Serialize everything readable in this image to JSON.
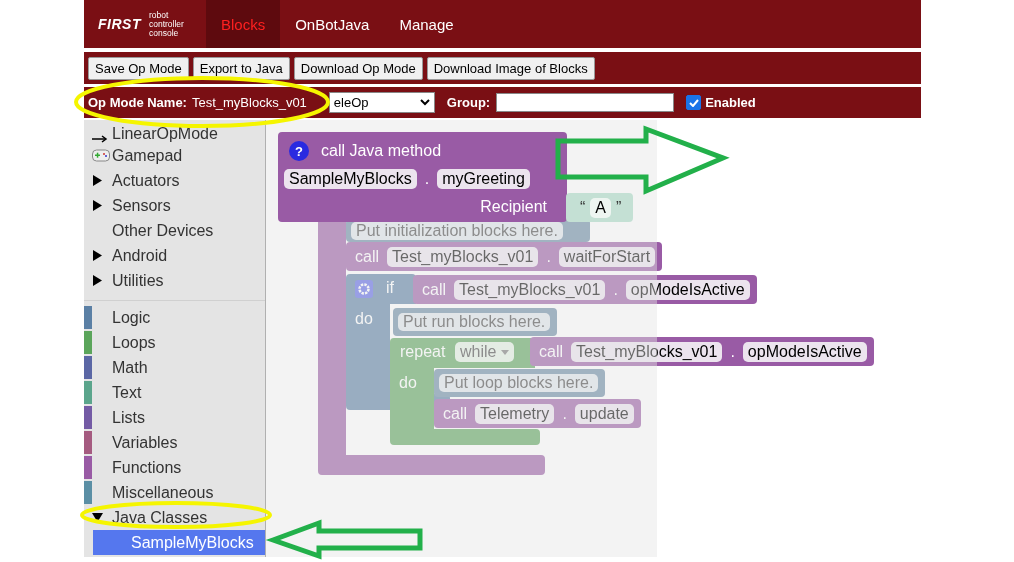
{
  "header": {
    "logo": "FIRST",
    "logo_caption": [
      "robot",
      "controller",
      "console"
    ],
    "tabs": [
      {
        "label": "Blocks",
        "selected": true
      },
      {
        "label": "OnBotJava",
        "selected": false
      },
      {
        "label": "Manage",
        "selected": false
      }
    ]
  },
  "toolbar": {
    "buttons": [
      "Save Op Mode",
      "Export to Java",
      "Download Op Mode",
      "Download Image of Blocks"
    ]
  },
  "op_mode_bar": {
    "name_label": "Op Mode Name:",
    "name": "Test_myBlocks_v01",
    "type_select": "eleOp",
    "group_label": "Group:",
    "enabled": {
      "label": "Enabled",
      "checked": true
    }
  },
  "toolbox": {
    "items": [
      {
        "label": "LinearOpMode",
        "kind": "arrow"
      },
      {
        "label": "Gamepad",
        "kind": "gamepad"
      },
      {
        "label": "Actuators",
        "kind": "folder",
        "expanded": false
      },
      {
        "label": "Sensors",
        "kind": "folder",
        "expanded": false
      },
      {
        "label": "Other Devices",
        "kind": "plain"
      },
      {
        "label": "Android",
        "kind": "folder",
        "expanded": false
      },
      {
        "label": "Utilities",
        "kind": "folder",
        "expanded": false
      }
    ],
    "categories": [
      {
        "label": "Logic",
        "color": "#5b80a5"
      },
      {
        "label": "Loops",
        "color": "#5ba55b"
      },
      {
        "label": "Math",
        "color": "#5b67a5"
      },
      {
        "label": "Text",
        "color": "#5ba58c"
      },
      {
        "label": "Lists",
        "color": "#745ba5"
      },
      {
        "label": "Variables",
        "color": "#a55b80"
      },
      {
        "label": "Functions",
        "color": "#995ba5"
      },
      {
        "label": "Miscellaneous",
        "color": "#5b8fa5"
      }
    ],
    "java_classes": {
      "label": "Java Classes",
      "expanded": true,
      "children": [
        {
          "label": "SampleMyBlocks",
          "selected": true
        }
      ]
    }
  },
  "flyout_block": {
    "help": "?",
    "title": "call Java method",
    "class": "SampleMyBlocks",
    "dot": ".",
    "method": "myGreeting",
    "param": "Recipient",
    "arg": {
      "open_quote": "“",
      "value": "A",
      "close_quote": "”"
    }
  },
  "blocks": [
    {
      "kind": "comment",
      "text": "Put initialization blocks here."
    },
    {
      "kind": "call",
      "keyword": "call",
      "target": "Test_myBlocks_v01",
      "dot": ".",
      "method": "waitForStart"
    },
    {
      "kind": "if",
      "label": "if",
      "do_label": "do"
    },
    {
      "kind": "call",
      "keyword": "call",
      "target": "Test_myBlocks_v01",
      "dot": ".",
      "method": "opModeIsActive"
    },
    {
      "kind": "comment",
      "text": "Put run blocks here."
    },
    {
      "kind": "repeat",
      "label": "repeat",
      "mode": "while",
      "do_label": "do"
    },
    {
      "kind": "call",
      "keyword": "call",
      "target": "Test_myBlocks_v01",
      "dot": ".",
      "method": "opModeIsActive"
    },
    {
      "kind": "comment",
      "text": "Put loop blocks here."
    },
    {
      "kind": "call",
      "keyword": "call",
      "target": "Telemetry",
      "dot": ".",
      "method": "update"
    }
  ]
}
